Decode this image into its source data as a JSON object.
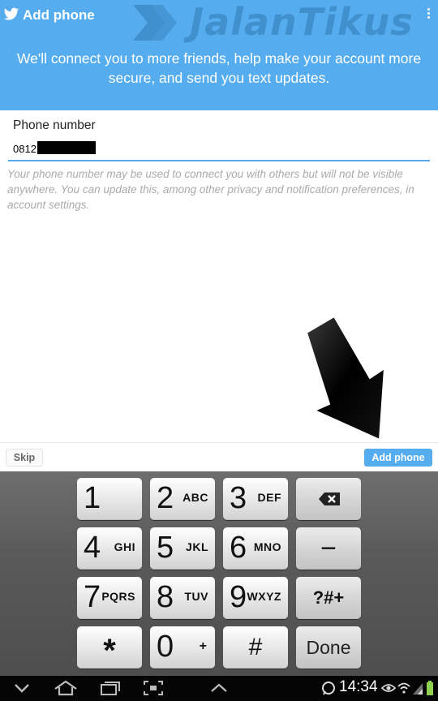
{
  "header": {
    "title": "Add phone",
    "subtitle": "We'll connect you to more friends, help make your account more secure, and send you text updates.",
    "watermark": "JalanTikus",
    "background": "#55acee"
  },
  "form": {
    "phone_label": "Phone number",
    "phone_value": "0812",
    "helper_text": "Your phone number may be used to connect you with others but will not be visible anywhere. You can update this, among other privacy and notification preferences, in account settings."
  },
  "actions": {
    "skip_label": "Skip",
    "add_label": "Add phone"
  },
  "keypad": {
    "keys": [
      {
        "num": "1",
        "letters": ""
      },
      {
        "num": "2",
        "letters": "ABC"
      },
      {
        "num": "3",
        "letters": "DEF"
      },
      {
        "num": "4",
        "letters": "GHI"
      },
      {
        "num": "5",
        "letters": "JKL"
      },
      {
        "num": "6",
        "letters": "MNO"
      },
      {
        "num": "7",
        "letters": "PQRS"
      },
      {
        "num": "8",
        "letters": "TUV"
      },
      {
        "num": "9",
        "letters": "WXYZ"
      },
      {
        "num": "0",
        "letters": "+"
      }
    ],
    "minus": "−",
    "symbols": "?#+",
    "star": "*",
    "hash": "#",
    "done": "Done"
  },
  "status": {
    "time": "14:34"
  },
  "icons": {
    "twitter": "twitter-bird-icon",
    "overflow": "overflow-menu-icon",
    "backspace": "backspace-icon",
    "nav": [
      "back-icon",
      "home-icon",
      "recent-apps-icon",
      "screenshot-icon",
      "up-icon"
    ],
    "status": [
      "whatsapp-icon",
      "eye-icon",
      "wifi-icon",
      "signal-icon",
      "battery-icon"
    ]
  }
}
